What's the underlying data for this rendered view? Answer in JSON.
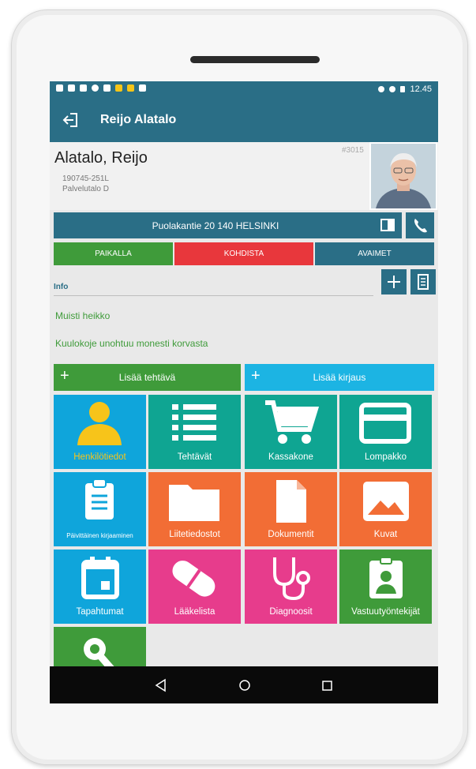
{
  "statusbar": {
    "time": "12.45"
  },
  "appbar": {
    "title": "Reijo Alatalo"
  },
  "patient": {
    "name": "Alatalo, Reijo",
    "id": "190745-251L",
    "unit": "Palvelutalo D",
    "number": "#3015"
  },
  "address": "Puolakantie 20 140 HELSINKI",
  "status": [
    {
      "label": "PAIKALLA",
      "color": "#3f9b3a"
    },
    {
      "label": "KOHDISTA",
      "color": "#e8373c"
    },
    {
      "label": "AVAIMET",
      "color": "#2a6e86"
    }
  ],
  "info": {
    "label": "Info",
    "notes": [
      "Muisti heikko",
      "Kuulokoje unohtuu monesti korvasta"
    ]
  },
  "actions": {
    "add_task": "Lisää tehtävä",
    "add_entry": "Lisää kirjaus"
  },
  "tiles": [
    {
      "label": "Henkilötiedot",
      "icon": "person-icon",
      "color": "#0fa5db"
    },
    {
      "label": "Tehtävät",
      "icon": "list-icon",
      "color": "#0fa592"
    },
    {
      "label": "Kassakone",
      "icon": "cart-icon",
      "color": "#0fa592"
    },
    {
      "label": "Lompakko",
      "icon": "wallet-icon",
      "color": "#0fa592"
    },
    {
      "label": "Päivittäinen kirjaaminen",
      "icon": "clipboard-icon",
      "color": "#0fa5db"
    },
    {
      "label": "Liitetiedostot",
      "icon": "folder-icon",
      "color": "#f26d35"
    },
    {
      "label": "Dokumentit",
      "icon": "document-icon",
      "color": "#f26d35"
    },
    {
      "label": "Kuvat",
      "icon": "image-icon",
      "color": "#f26d35"
    },
    {
      "label": "Tapahtumat",
      "icon": "calendar-icon",
      "color": "#0fa5db"
    },
    {
      "label": "Lääkelista",
      "icon": "pill-icon",
      "color": "#e73c8c"
    },
    {
      "label": "Diagnoosit",
      "icon": "stethoscope-icon",
      "color": "#e73c8c"
    },
    {
      "label": "Vastuutyöntekijät",
      "icon": "badge-icon",
      "color": "#3f9b3a"
    },
    {
      "label": "",
      "icon": "key-icon",
      "color": "#3f9b3a"
    }
  ]
}
